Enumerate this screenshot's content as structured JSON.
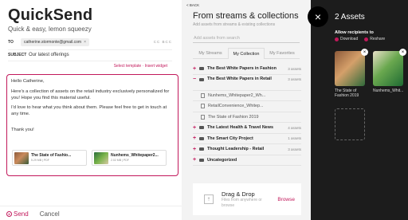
{
  "compose": {
    "brand": "QuickSend",
    "tagline": "Quick & easy, lemon squeezy",
    "to_label": "TO",
    "recipient": "catherine.stormonte@gmail.com",
    "recipient_remove": "×",
    "cc_bcc": "CC BCC",
    "subject_label": "SUBJECT",
    "subject": "Our latest offerings",
    "select_template": "Select template",
    "separator": " · ",
    "insert_widget": "Insert widget",
    "body": {
      "greeting": "Hello Catherine,",
      "p1": "Here's a collection of assets on the retail industry exclusively personalized for you! Hope you find this material useful.",
      "p2": "I'd love to hear what you think about them. Please feel free to get in touch at any time.",
      "thanks": "Thank you!"
    },
    "attachments": [
      {
        "name": "The State of Fashio...",
        "meta": "5.29 MB | PDF"
      },
      {
        "name": "Nunhems_Whitepaper2...",
        "meta": "2.02 MB | PDF"
      }
    ],
    "send_label": "Send",
    "cancel_label": "Cancel"
  },
  "library": {
    "back_label": "< BACK",
    "title": "From streams & collections",
    "subtitle": "Add assets from streams & existing collections",
    "search_placeholder": "Add assets from search",
    "tabs": [
      "My Streams",
      "My Collection",
      "My Favorites"
    ],
    "active_tab": "My Collection",
    "tree": [
      {
        "sign": "+",
        "name": "The Best White Papers in Fashion",
        "count": "3 assets"
      },
      {
        "sign": "−",
        "name": "The Best White Papers in Retail",
        "count": "3 assets"
      },
      {
        "child": true,
        "name": "Nunhems_Whitepaper2_Wh..."
      },
      {
        "child": true,
        "name": "RetailConvenience_Whitep..."
      },
      {
        "child": true,
        "name": "The State of Fashion 2019"
      },
      {
        "sign": "+",
        "name": "The Latest Health & Travel News",
        "count": "4 assets"
      },
      {
        "sign": "+",
        "name": "The Smart City Project",
        "count": "1 assets"
      },
      {
        "sign": "+",
        "name": "Thought Leadership - Retail",
        "count": "3 assets"
      },
      {
        "sign": "+",
        "name": "Uncategorized",
        "count": ""
      }
    ],
    "dropzone": {
      "title": "Drag & Drop",
      "sub": "Files from anywhere or browse",
      "browse": "Browse"
    }
  },
  "close_icon": "×",
  "assets": {
    "title": "2 Assets",
    "allow_label": "Allow recipients to",
    "perms": [
      "Download",
      "Reshare"
    ],
    "items": [
      {
        "label": "The State of Fashion 2019"
      },
      {
        "label": "Nunhems_Whit..."
      }
    ],
    "remove_icon": "×"
  },
  "colors": {
    "accent": "#c2185b",
    "dark_panel": "#1c1c1c",
    "mid_panel": "#f3f3f3"
  }
}
